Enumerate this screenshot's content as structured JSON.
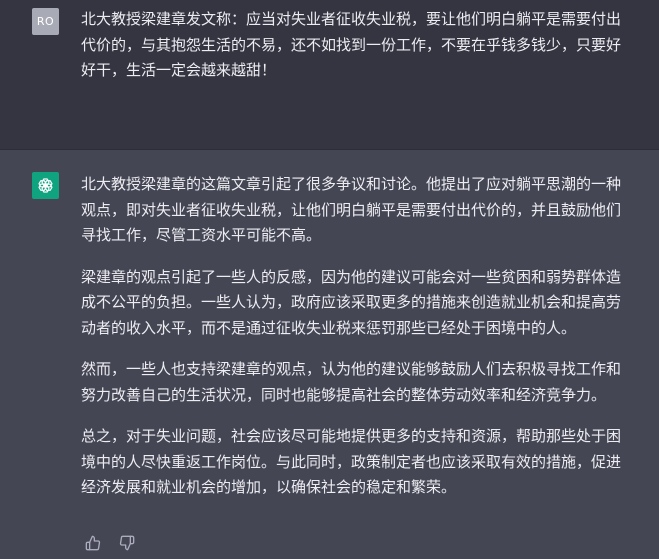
{
  "user_message": {
    "avatar_initials": "RO",
    "text": "北大教授梁建章发文称：应当对失业者征收失业税，要让他们明白躺平是需要付出代价的，与其抱怨生活的不易，还不如找到一份工作，不要在乎钱多钱少，只要好好干，生活一定会越来越甜！"
  },
  "assistant_message": {
    "avatar_icon": "openai-logo-icon",
    "paragraphs": [
      "北大教授梁建章的这篇文章引起了很多争议和讨论。他提出了应对躺平思潮的一种观点，即对失业者征收失业税，让他们明白躺平是需要付出代价的，并且鼓励他们寻找工作，尽管工资水平可能不高。",
      "梁建章的观点引起了一些人的反感，因为他的建议可能会对一些贫困和弱势群体造成不公平的负担。一些人认为，政府应该采取更多的措施来创造就业机会和提高劳动者的收入水平，而不是通过征收失业税来惩罚那些已经处于困境中的人。",
      "然而，一些人也支持梁建章的观点，认为他的建议能够鼓励人们去积极寻找工作和努力改善自己的生活状况，同时也能够提高社会的整体劳动效率和经济竞争力。",
      "总之，对于失业问题，社会应该尽可能地提供更多的支持和资源，帮助那些处于困境中的人尽快重返工作岗位。与此同时，政策制定者也应该采取有效的措施，促进经济发展和就业机会的增加，以确保社会的稳定和繁荣。"
    ],
    "feedback": {
      "like_icon": "thumbs-up-icon",
      "dislike_icon": "thumbs-down-icon"
    }
  },
  "colors": {
    "user_bg": "#343541",
    "assistant_bg": "#444654",
    "text": "#ececf1",
    "brand_green": "#10a37f",
    "user_avatar_bg": "#a8aab5",
    "icon": "#acacbe"
  }
}
